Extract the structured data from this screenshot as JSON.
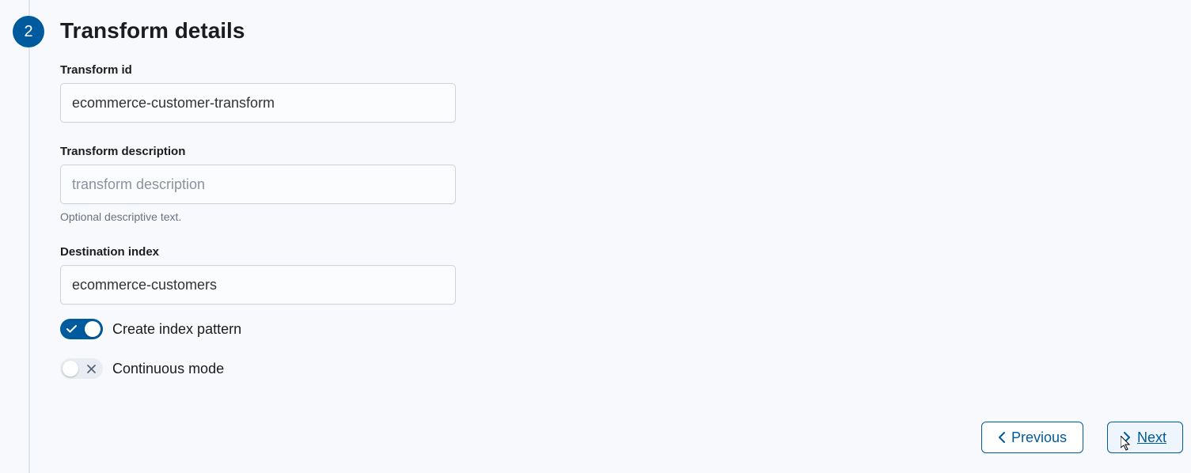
{
  "step": {
    "number": "2",
    "title": "Transform details"
  },
  "fields": {
    "transform_id": {
      "label": "Transform id",
      "value": "ecommerce-customer-transform"
    },
    "transform_description": {
      "label": "Transform description",
      "placeholder": "transform description",
      "value": "",
      "help": "Optional descriptive text."
    },
    "destination_index": {
      "label": "Destination index",
      "value": "ecommerce-customers"
    }
  },
  "toggles": {
    "create_index_pattern": {
      "label": "Create index pattern",
      "state": "on"
    },
    "continuous_mode": {
      "label": "Continuous mode",
      "state": "off"
    }
  },
  "buttons": {
    "previous": "Previous",
    "next": "Next"
  }
}
